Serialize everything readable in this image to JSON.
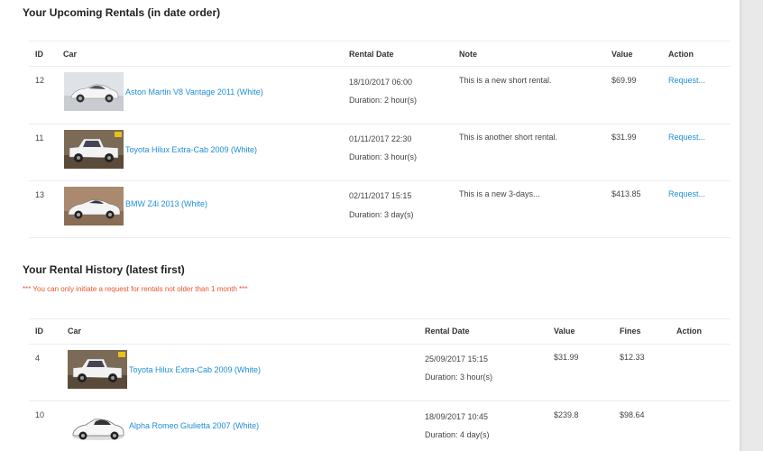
{
  "upcoming": {
    "title": "Your Upcoming Rentals (in date order)",
    "headers": {
      "id": "ID",
      "car": "Car",
      "rental_date": "Rental Date",
      "note": "Note",
      "value": "Value",
      "action": "Action"
    },
    "rows": [
      {
        "id": "12",
        "car": "Aston Martin V8 Vantage 2011 (White)",
        "date": "18/10/2017 06:00",
        "duration": "Duration: 2 hour(s)",
        "note": "This is a new short rental.",
        "value": "$69.99",
        "action": "Request..."
      },
      {
        "id": "11",
        "car": "Toyota Hilux Extra-Cab 2009 (White)",
        "date": "01/11/2017 22:30",
        "duration": "Duration: 3 hour(s)",
        "note": "This is another short rental.",
        "value": "$31.99",
        "action": "Request..."
      },
      {
        "id": "13",
        "car": "BMW Z4i 2013 (White)",
        "date": "02/11/2017 15:15",
        "duration": "Duration: 3 day(s)",
        "note": "This is a new 3-days...",
        "value": "$413.85",
        "action": "Request..."
      }
    ]
  },
  "history": {
    "title": "Your Rental History (latest first)",
    "warning": "*** You can only initiate a request for rentals not older than 1 month ***",
    "headers": {
      "id": "ID",
      "car": "Car",
      "rental_date": "Rental Date",
      "value": "Value",
      "fines": "Fines",
      "action": "Action"
    },
    "rows": [
      {
        "id": "4",
        "car": "Toyota Hilux Extra-Cab 2009 (White)",
        "date": "25/09/2017 15:15",
        "duration": "Duration: 3 hour(s)",
        "value": "$31.99",
        "fines": "$12.33"
      },
      {
        "id": "10",
        "car": "Alpha Romeo Giulietta 2007 (White)",
        "date": "18/09/2017 10:45",
        "duration": "Duration: 4 day(s)",
        "value": "$239.8",
        "fines": "$98.64"
      }
    ]
  },
  "icons": {
    "car_thumbnail": "car-photo-icon"
  },
  "colors": {
    "link": "#1e8fd6",
    "warning": "#e8552d"
  }
}
